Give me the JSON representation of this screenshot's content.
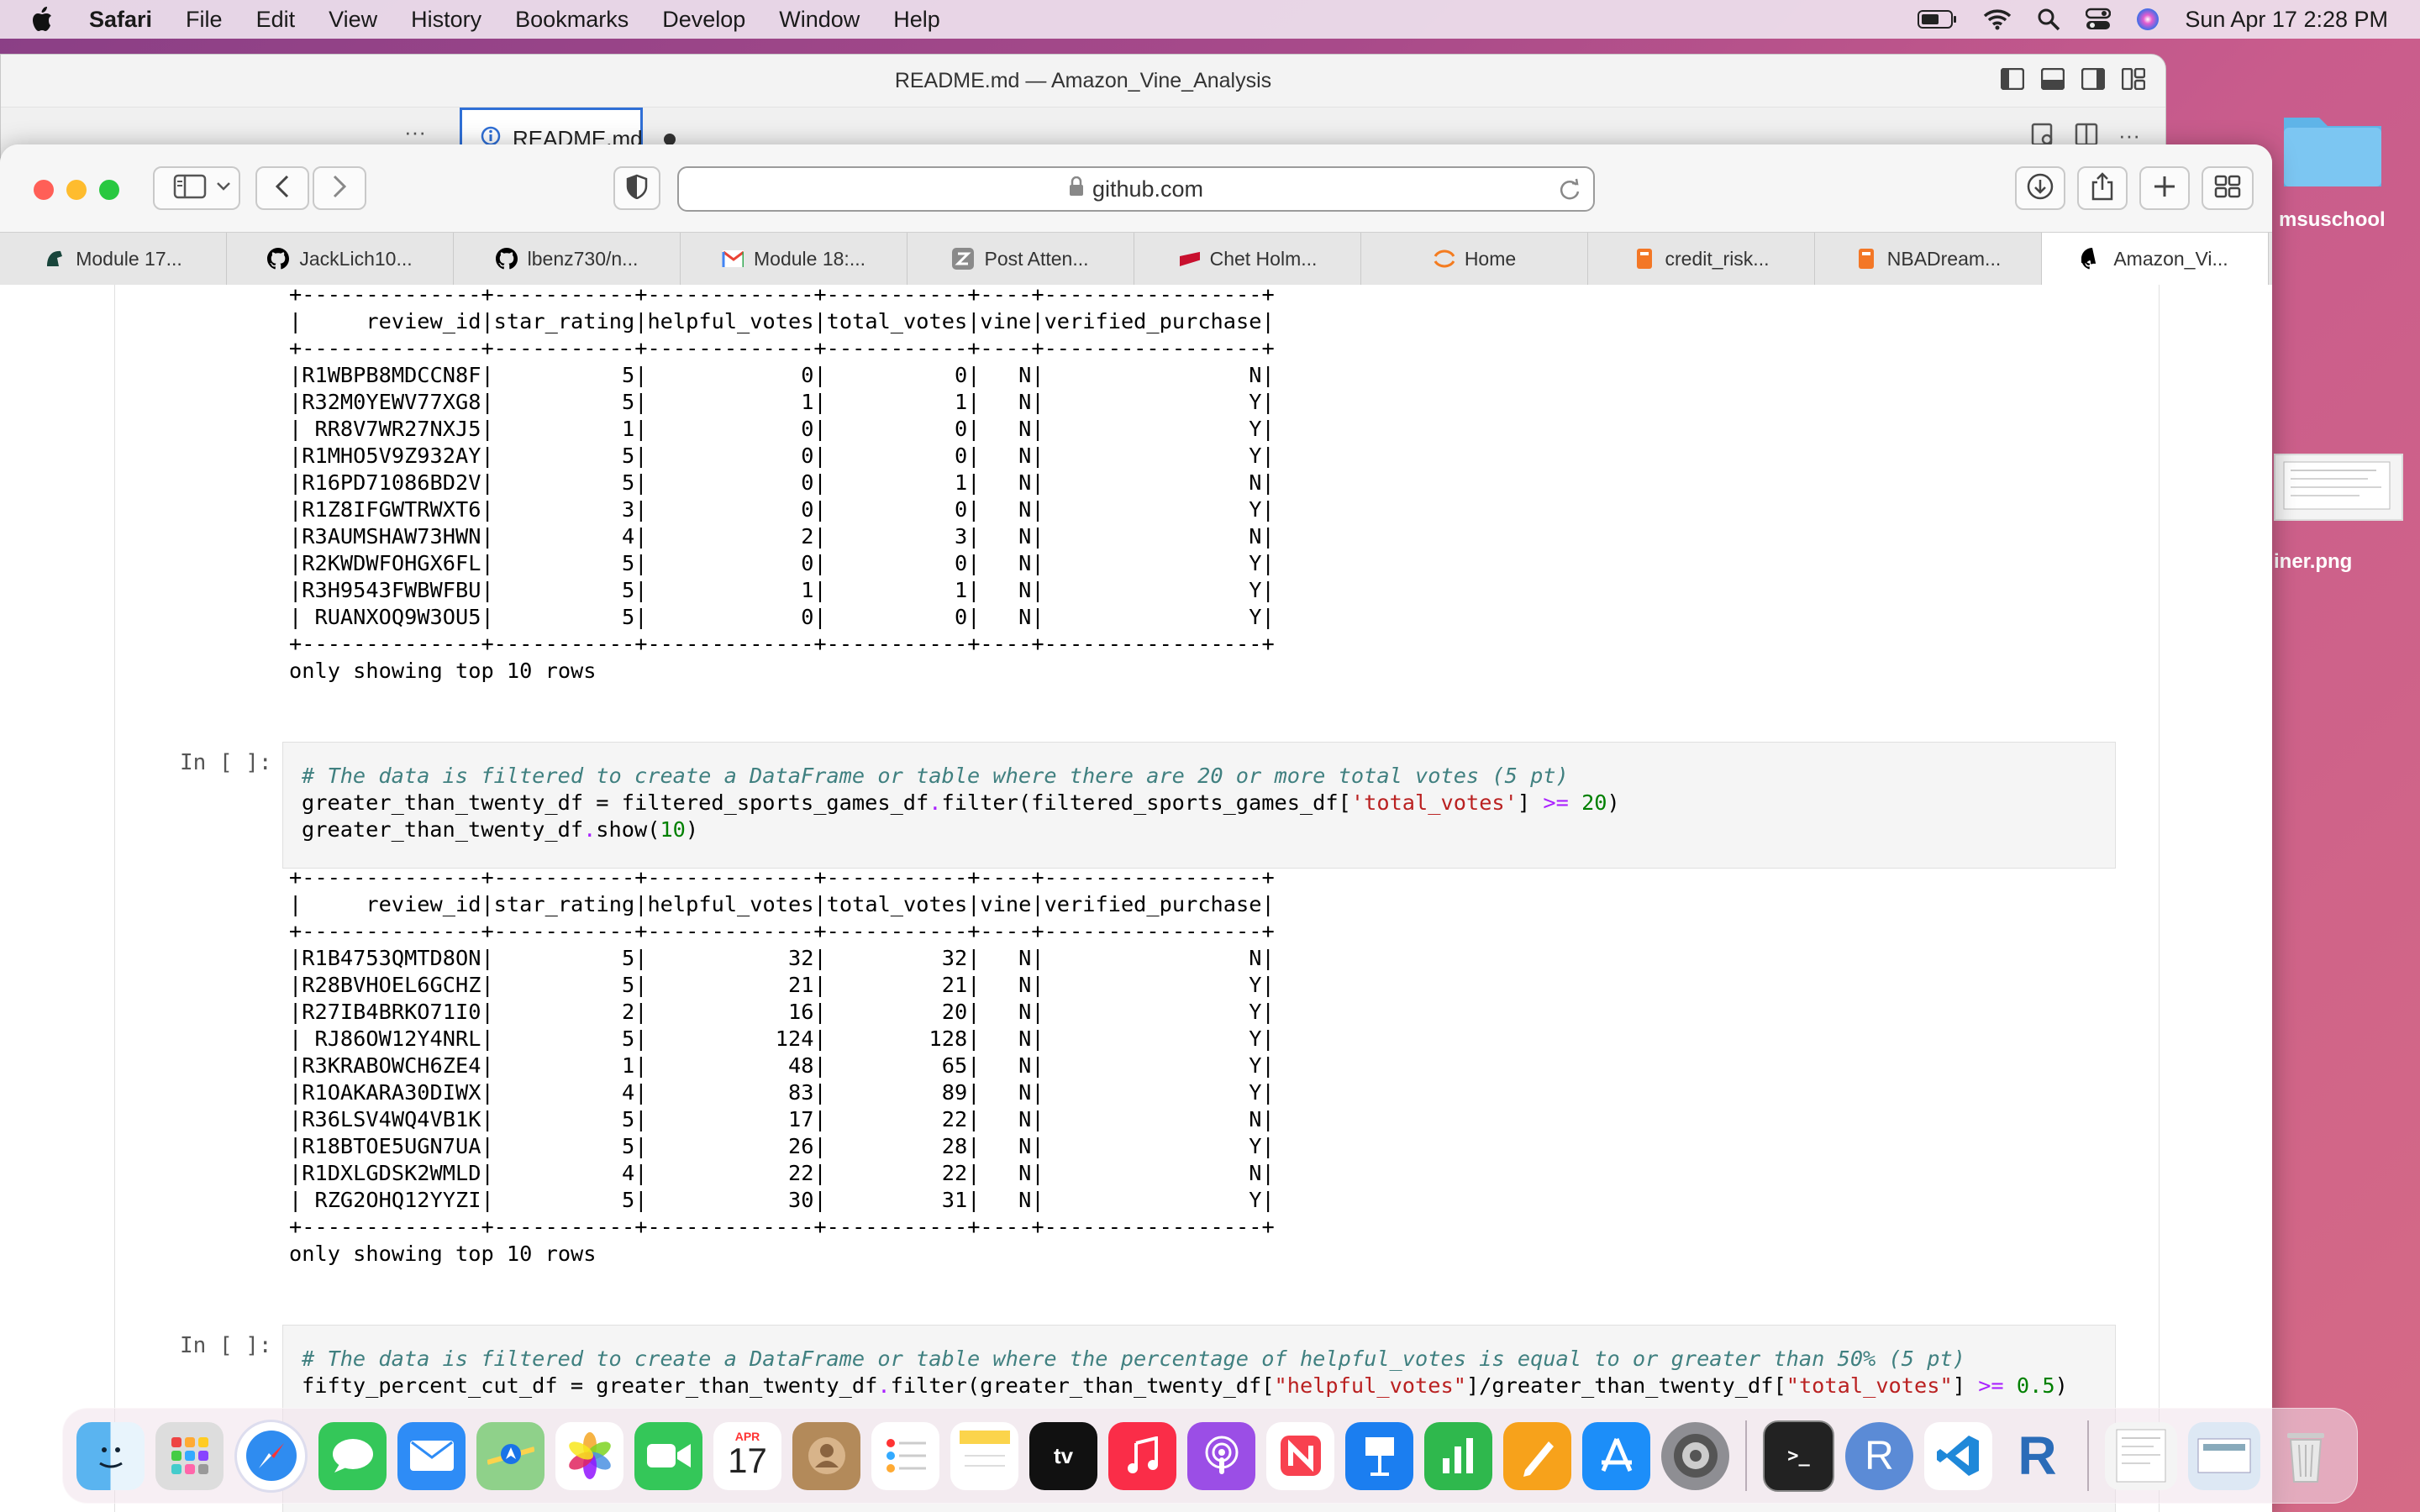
{
  "menubar": {
    "app": "Safari",
    "items": [
      "File",
      "Edit",
      "View",
      "History",
      "Bookmarks",
      "Develop",
      "Window",
      "Help"
    ],
    "clock": "Sun Apr 17  2:28 PM"
  },
  "desktop": {
    "folder_label": "msuschool",
    "file_label": "iner.png"
  },
  "vscode": {
    "title": "README.md — Amazon_Vine_Analysis",
    "tab_label": "README.md",
    "more": "···"
  },
  "safari": {
    "url": "github.com",
    "tabs": [
      {
        "label": "Module 17...",
        "icon": "spartan-icon",
        "color": "#18453b"
      },
      {
        "label": "JackLich10...",
        "icon": "github-icon",
        "color": "#000000"
      },
      {
        "label": "lbenz730/n...",
        "icon": "github-icon",
        "color": "#000000"
      },
      {
        "label": "Module 18:...",
        "icon": "gmail-icon",
        "color": "#ea4335"
      },
      {
        "label": "Post Atten...",
        "icon": "z-icon",
        "color": "#8a8a8a"
      },
      {
        "label": "Chet Holm...",
        "icon": "redbook-icon",
        "color": "#c8102e"
      },
      {
        "label": "Home",
        "icon": "orange-arc-icon",
        "color": "#f47c20"
      },
      {
        "label": "credit_risk...",
        "icon": "notebook-icon",
        "color": "#f37726"
      },
      {
        "label": "NBADream...",
        "icon": "notebook-icon",
        "color": "#f37726"
      },
      {
        "label": "Amazon_Vi...",
        "icon": "github-icon",
        "color": "#000000"
      }
    ]
  },
  "notebook": {
    "output1": "+--------------+-----------+-------------+-----------+----+-----------------+\n|     review_id|star_rating|helpful_votes|total_votes|vine|verified_purchase|\n+--------------+-----------+-------------+-----------+----+-----------------+\n|R1WBPB8MDCCN8F|          5|            0|          0|   N|                N|\n|R32M0YEWV77XG8|          5|            1|          1|   N|                Y|\n| RR8V7WR27NXJ5|          1|            0|          0|   N|                Y|\n|R1MHO5V9Z932AY|          5|            0|          0|   N|                Y|\n|R16PD71086BD2V|          5|            0|          1|   N|                N|\n|R1Z8IFGWTRWXT6|          3|            0|          0|   N|                Y|\n|R3AUMSHAW73HWN|          4|            2|          3|   N|                N|\n|R2KWDWFOHGX6FL|          5|            0|          0|   N|                Y|\n|R3H9543FWBWFBU|          5|            1|          1|   N|                Y|\n| RUANXOQ9W3OU5|          5|            0|          0|   N|                Y|\n+--------------+-----------+-------------+-----------+----+-----------------+\nonly showing top 10 rows",
    "prompt1": "In [ ]:",
    "cell1": {
      "comment": "# The data is filtered to create a DataFrame or table where there are 20 or more total votes (5 pt)",
      "l2a": "greater_than_twenty_df = filtered_sports_games_df",
      "l2b": "filter(filtered_sports_games_df[",
      "l2c": "'total_votes'",
      "l2d": "] ",
      "l2e": ">=",
      "l2f": "20",
      "l2g": ")",
      "l3a": "greater_than_twenty_df",
      "l3b": "show(",
      "l3c": "10",
      "l3d": ")"
    },
    "output2": "+--------------+-----------+-------------+-----------+----+-----------------+\n|     review_id|star_rating|helpful_votes|total_votes|vine|verified_purchase|\n+--------------+-----------+-------------+-----------+----+-----------------+\n|R1B4753QMTD8ON|          5|           32|         32|   N|                N|\n|R28BVHOEL6GCHZ|          5|           21|         21|   N|                Y|\n|R27IB4BRKO71I0|          2|           16|         20|   N|                Y|\n| RJ86OW12Y4NRL|          5|          124|        128|   N|                Y|\n|R3KRABOWCH6ZE4|          1|           48|         65|   N|                Y|\n|R1OAKARA30DIWX|          4|           83|         89|   N|                Y|\n|R36LSV4WQ4VB1K|          5|           17|         22|   N|                N|\n|R18BTOE5UGN7UA|          5|           26|         28|   N|                Y|\n|R1DXLGDSK2WMLD|          4|           22|         22|   N|                N|\n| RZG2OHQ12YYZI|          5|           30|         31|   N|                Y|\n+--------------+-----------+-------------+-----------+----+-----------------+\nonly showing top 10 rows",
    "prompt2": "In [ ]:",
    "cell2": {
      "comment": "# The data is filtered to create a DataFrame or table where the percentage of helpful_votes is equal to or greater than 50% (5 pt)",
      "l2a": "fifty_percent_cut_df = greater_than_twenty_df",
      "l2b": "filter(greater_than_twenty_df[",
      "l2c": "\"helpful_votes\"",
      "l2d": "]/greater_than_twenty_df[",
      "l2e": "\"total_votes\"",
      "l2f": "] ",
      "l2g": ">=",
      "l2h": "0.5",
      "l2i": ")"
    }
  },
  "dock": {
    "calendar_month": "APR",
    "calendar_day": "17",
    "apps": [
      "finder-icon",
      "launchpad-icon",
      "safari-icon",
      "messages-icon",
      "mail-icon",
      "maps-icon",
      "photos-icon",
      "facetime-icon",
      "calendar-icon",
      "contacts-icon",
      "reminders-icon",
      "notes-icon",
      "apple-tv-icon",
      "music-icon",
      "podcasts-icon",
      "news-icon",
      "keynote-icon",
      "numbers-icon",
      "pages-icon",
      "app-store-icon",
      "system-preferences-icon",
      "terminal-icon",
      "r-icon",
      "vscode-icon",
      "rstudio-icon"
    ]
  }
}
